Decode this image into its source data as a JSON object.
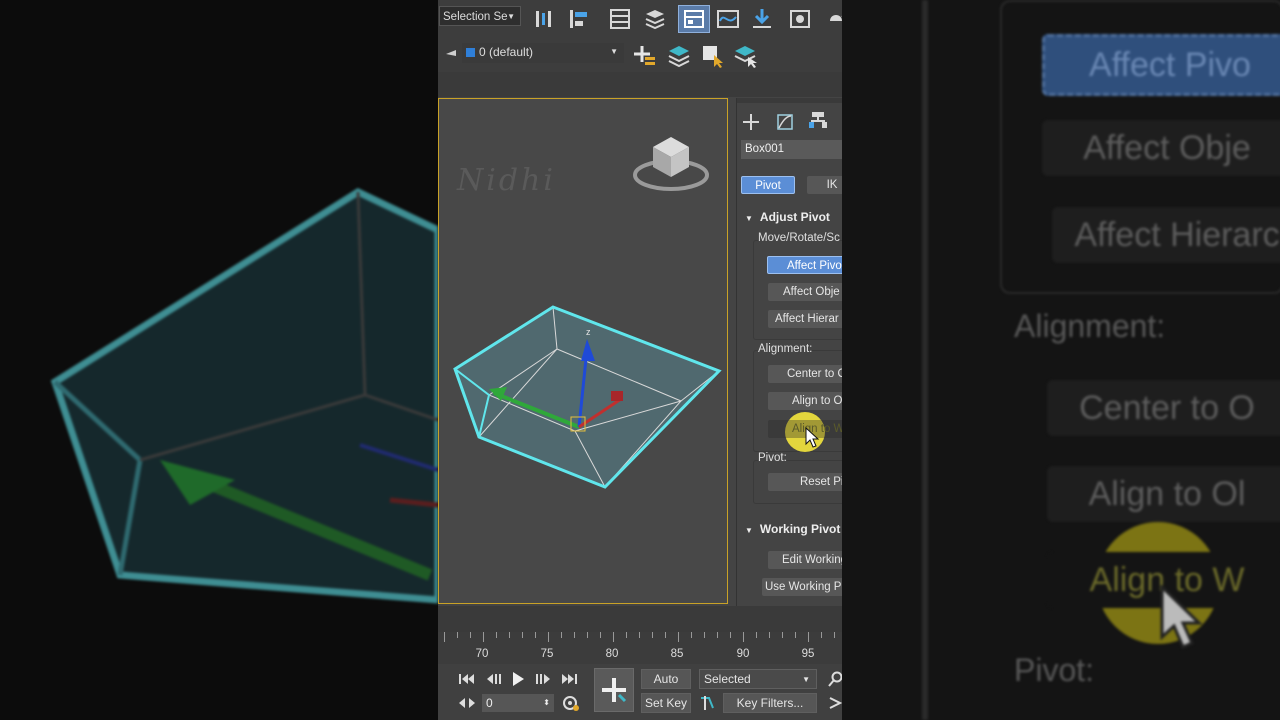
{
  "toolbar": {
    "selection_filter": "Selection Se",
    "layer_name": "0 (default)"
  },
  "viewport": {
    "watermark": "Nidhi",
    "gizmo_z_label": "z",
    "accent_color": "#60e6ec",
    "border_color": "#c9a227"
  },
  "command_panel": {
    "object_name": "Box001",
    "tabs": [
      "Pivot",
      "IK"
    ],
    "adjust_pivot_title": "Adjust Pivot",
    "move_rotate_label": "Move/Rotate/Sc",
    "affect_pivot": "Affect Pivo",
    "affect_object": "Affect Obje",
    "affect_hierarchy": "Affect Hierar",
    "alignment_label": "Alignment:",
    "center_to": "Center to O",
    "align_to_object": "Align to Ol",
    "align_to_world": "Align to W",
    "pivot_label": "Pivot:",
    "reset_pivot": "Reset Pi",
    "working_pivot_title": "Working Pivot",
    "edit_working": "Edit Working",
    "use_working": "Use Working Pi",
    "active_color": "#5b8ed6"
  },
  "timeline": {
    "ticks": [
      "70",
      "75",
      "80",
      "85",
      "90",
      "95"
    ]
  },
  "playback": {
    "frame_value": "0",
    "auto_key": "Auto Key",
    "set_key": "Set Key",
    "key_mode": "Selected",
    "key_filters": "Key Filters..."
  },
  "zoom_overlay": {
    "affect_pivot": "Affect Pivo",
    "affect_object": "Affect Obje",
    "affect_hierarchy": "Affect Hierarc",
    "alignment": "Alignment:",
    "center_to": "Center to O",
    "align_to_object": "Align to Ol",
    "align_to_world": "Align to W",
    "pivot": "Pivot:"
  }
}
